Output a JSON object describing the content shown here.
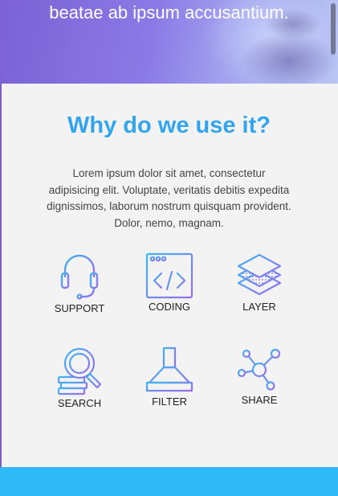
{
  "hero": {
    "text": "beatae ab ipsum accusantium."
  },
  "section": {
    "title": "Why do we use it?",
    "description": "Lorem ipsum dolor sit amet, consectetur adipisicing elit. Voluptate, veritatis debitis expedita dignissimos, laborum nostrum quisquam provident. Dolor, nemo, magnam."
  },
  "features": [
    {
      "label": "SUPPORT",
      "icon": "headset-icon"
    },
    {
      "label": "CODING",
      "icon": "code-window-icon"
    },
    {
      "label": "LAYER",
      "icon": "layers-icon"
    },
    {
      "label": "SEARCH",
      "icon": "magnifier-icon"
    },
    {
      "label": "FILTER",
      "icon": "range-hood-icon"
    },
    {
      "label": "SHARE",
      "icon": "share-network-icon"
    }
  ],
  "colors": {
    "title": "#33a4ee",
    "icon_gradient_start": "#3db6f2",
    "icon_gradient_end": "#9b6de8",
    "footer": "#2fb9f6"
  }
}
